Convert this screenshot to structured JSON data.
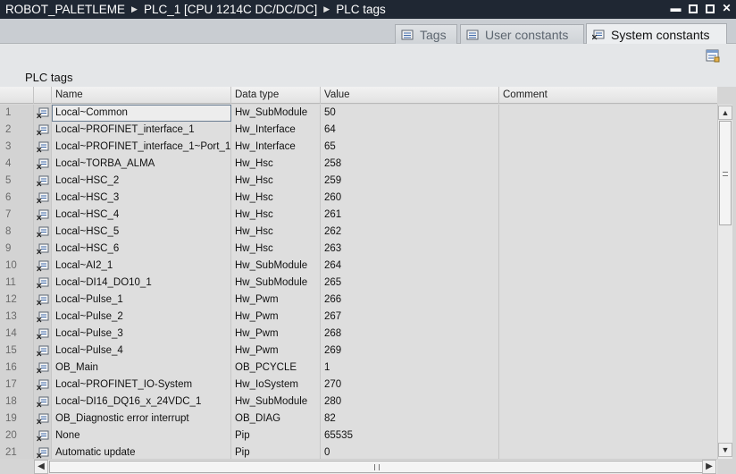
{
  "breadcrumb": [
    "ROBOT_PALETLEME",
    "PLC_1 [CPU 1214C DC/DC/DC]",
    "PLC tags"
  ],
  "window_controls": [
    "minimize-icon",
    "restore-icon",
    "close-icon"
  ],
  "tabs": [
    {
      "label": "Tags",
      "active": false
    },
    {
      "label": "User constants",
      "active": false
    },
    {
      "label": "System constants",
      "active": true
    }
  ],
  "panel_title": "PLC tags",
  "columns": {
    "num": "",
    "icon": "",
    "name": "Name",
    "type": "Data type",
    "value": "Value",
    "comment": "Comment"
  },
  "rows": [
    {
      "n": "1",
      "name": "Local~Common",
      "type": "Hw_SubModule",
      "value": "50",
      "comment": ""
    },
    {
      "n": "2",
      "name": "Local~PROFINET_interface_1",
      "type": "Hw_Interface",
      "value": "64",
      "comment": ""
    },
    {
      "n": "3",
      "name": "Local~PROFINET_interface_1~Port_1",
      "type": "Hw_Interface",
      "value": "65",
      "comment": ""
    },
    {
      "n": "4",
      "name": "Local~TORBA_ALMA",
      "type": "Hw_Hsc",
      "value": "258",
      "comment": ""
    },
    {
      "n": "5",
      "name": "Local~HSC_2",
      "type": "Hw_Hsc",
      "value": "259",
      "comment": ""
    },
    {
      "n": "6",
      "name": "Local~HSC_3",
      "type": "Hw_Hsc",
      "value": "260",
      "comment": ""
    },
    {
      "n": "7",
      "name": "Local~HSC_4",
      "type": "Hw_Hsc",
      "value": "261",
      "comment": ""
    },
    {
      "n": "8",
      "name": "Local~HSC_5",
      "type": "Hw_Hsc",
      "value": "262",
      "comment": ""
    },
    {
      "n": "9",
      "name": "Local~HSC_6",
      "type": "Hw_Hsc",
      "value": "263",
      "comment": ""
    },
    {
      "n": "10",
      "name": "Local~AI2_1",
      "type": "Hw_SubModule",
      "value": "264",
      "comment": ""
    },
    {
      "n": "11",
      "name": "Local~DI14_DO10_1",
      "type": "Hw_SubModule",
      "value": "265",
      "comment": ""
    },
    {
      "n": "12",
      "name": "Local~Pulse_1",
      "type": "Hw_Pwm",
      "value": "266",
      "comment": ""
    },
    {
      "n": "13",
      "name": "Local~Pulse_2",
      "type": "Hw_Pwm",
      "value": "267",
      "comment": ""
    },
    {
      "n": "14",
      "name": "Local~Pulse_3",
      "type": "Hw_Pwm",
      "value": "268",
      "comment": ""
    },
    {
      "n": "15",
      "name": "Local~Pulse_4",
      "type": "Hw_Pwm",
      "value": "269",
      "comment": ""
    },
    {
      "n": "16",
      "name": "OB_Main",
      "type": "OB_PCYCLE",
      "value": "1",
      "comment": ""
    },
    {
      "n": "17",
      "name": "Local~PROFINET_IO-System",
      "type": "Hw_IoSystem",
      "value": "270",
      "comment": ""
    },
    {
      "n": "18",
      "name": "Local~DI16_DQ16_x_24VDC_1",
      "type": "Hw_SubModule",
      "value": "280",
      "comment": ""
    },
    {
      "n": "19",
      "name": "OB_Diagnostic error interrupt",
      "type": "OB_DIAG",
      "value": "82",
      "comment": ""
    },
    {
      "n": "20",
      "name": "None",
      "type": "Pip",
      "value": "65535",
      "comment": ""
    },
    {
      "n": "21",
      "name": "Automatic update",
      "type": "Pip",
      "value": "0",
      "comment": ""
    }
  ],
  "colors": {
    "titlebar": "#1f2733",
    "tab_active": "#eceef0",
    "row_bg": "#dedede",
    "selection_border": "#6a7d92"
  }
}
